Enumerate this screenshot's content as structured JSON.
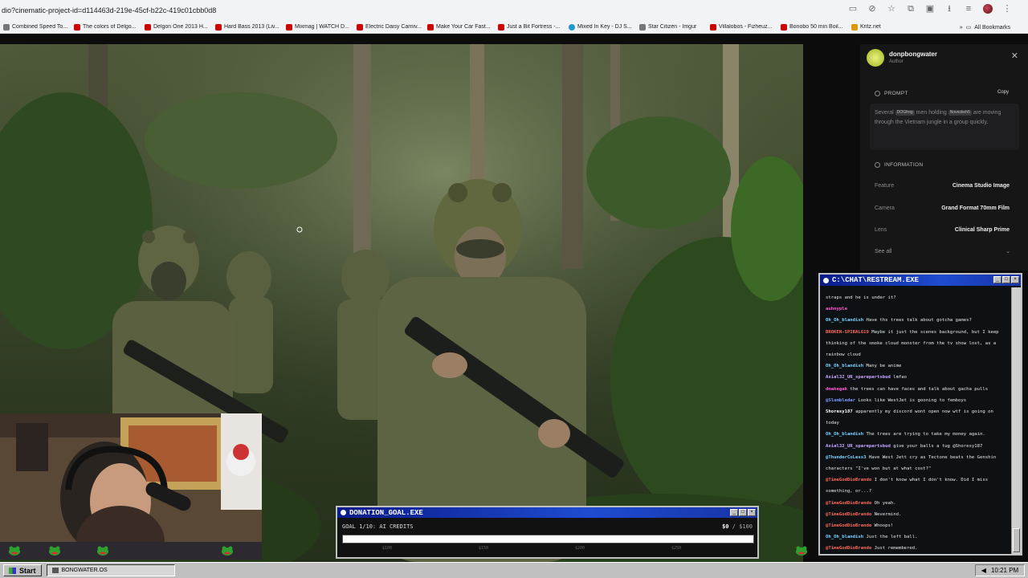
{
  "browser": {
    "url": "dio?cinematic-project-id=d114463d-219e-45cf-b22c-419c01cbb0d8",
    "bookmarks": [
      {
        "label": "Combined Speed To...",
        "fav": "g"
      },
      {
        "label": "The colors of Delgo...",
        "fav": "r"
      },
      {
        "label": "Delgon One 2013 H...",
        "fav": "r"
      },
      {
        "label": "Hard Bass 2013 (Liv...",
        "fav": "r"
      },
      {
        "label": "Mixmag | WATCH D...",
        "fav": "r"
      },
      {
        "label": "Electric Daisy Carniv...",
        "fav": "r"
      },
      {
        "label": "Make Your Car Fast...",
        "fav": "r"
      },
      {
        "label": "Just a Bit Fortress -...",
        "fav": "r"
      },
      {
        "label": "Mixed In Key - DJ S...",
        "fav": "b"
      },
      {
        "label": "Star Citizen - Imgur",
        "fav": "g"
      },
      {
        "label": "Villalobos - Fizheuz...",
        "fav": "r"
      },
      {
        "label": "Bonobo 50 min Boil...",
        "fav": "r"
      },
      {
        "label": "Kritz.net",
        "fav": "y"
      }
    ],
    "all_bookmarks": "All Bookmarks"
  },
  "panel": {
    "author_name": "donpbongwater",
    "author_role": "Author",
    "prompt_heading": "PROMPT",
    "copy_label": "Copy",
    "prompt": {
      "part1": "Several",
      "chip1": "DOGfrog",
      "part2": "men holding",
      "chip2": "Noveskeh5",
      "part3": "are moving through the Vietnam jungle in a group quickly."
    },
    "info_heading": "INFORMATION",
    "info": [
      {
        "label": "Feature",
        "value": "Cinema Studio Image"
      },
      {
        "label": "Camera",
        "value": "Grand Format 70mm Film"
      },
      {
        "label": "Lens",
        "value": "Clinical Sharp Prime"
      }
    ],
    "see_all": "See all"
  },
  "chat": {
    "title": "C:\\CHAT\\RESTREAM.EXE",
    "messages": [
      {
        "user": "",
        "color": "#e8e8e8",
        "text": "straps and he is under it?"
      },
      {
        "user": "auhnyple",
        "color": "#ff5ad2",
        "text": ""
      },
      {
        "user": "Oh_Oh_blandish",
        "color": "#7dd3ff",
        "text": "Have ths trees talk about gotcha games?"
      },
      {
        "user": "BROKEN-SPIRAL619",
        "color": "#ff6a5a",
        "text": "Maybe it just the scenes background, but I keep thinking of the smoke cloud monster from the tv show lost, as a rainbow cloud"
      },
      {
        "user": "Oh_Oh_blandish",
        "color": "#7dd3ff",
        "text": "Many be anime"
      },
      {
        "user": "Axial32_UR_sparepartsbud",
        "color": "#c9a7ff",
        "text": "lmfao"
      },
      {
        "user": "dmakegak",
        "color": "#ff5ad2",
        "text": "the trees can have faces and talk about gacha pulls"
      },
      {
        "user": "@Slumbledar",
        "color": "#7d9bff",
        "text": "Looks like WestJet is gooning to femboys"
      },
      {
        "user": "Shoresy187",
        "color": "#ffffff",
        "text": "apparently my discord wont open now wtf is going on today"
      },
      {
        "user": "Oh_Oh_blandish",
        "color": "#7dd3ff",
        "text": "The trees are trying to take my money again."
      },
      {
        "user": "Axial32_UR_sparepartsbud",
        "color": "#c9a7ff",
        "text": "give your balls a tug @Shoresy187"
      },
      {
        "user": "@ThunderCoLess3",
        "color": "#7dd3ff",
        "text": "Have West Jett cry as Tectone beats the Genshin characters \"I've won but at what cost?\""
      },
      {
        "user": "@TimeGodDioBrando",
        "color": "#ff6a5a",
        "text": "I don't know what I don't know. Did I miss something, or...?"
      },
      {
        "user": "@TimeGodDioBrando",
        "color": "#ff6a5a",
        "text": "Oh yeah."
      },
      {
        "user": "@TimeGodDioBrando",
        "color": "#ff6a5a",
        "text": "Nevermind."
      },
      {
        "user": "@TimeGodDioBrando",
        "color": "#ff6a5a",
        "text": "Whoops!"
      },
      {
        "user": "Oh_Oh_blandish",
        "color": "#7dd3ff",
        "text": "Just the left ball."
      },
      {
        "user": "@TimeGodDioBrando",
        "color": "#ff6a5a",
        "text": "Just remembered."
      }
    ]
  },
  "donation": {
    "title": "DONATION_GOAL.EXE",
    "goal_label": "GOAL 1/10: AI CREDITS",
    "current": "$0",
    "target": "/ $100",
    "progress": 0,
    "ticks": [
      "$100",
      "$150",
      "$200",
      "$250"
    ]
  },
  "taskbar": {
    "start_label": "Start",
    "task_label": "BONGWATER.OS",
    "clock": "10:21 PM"
  },
  "colors": {
    "title_bar": "#1e4cd0",
    "win_gray": "#c0c0c0",
    "panel_bg": "#161617"
  }
}
